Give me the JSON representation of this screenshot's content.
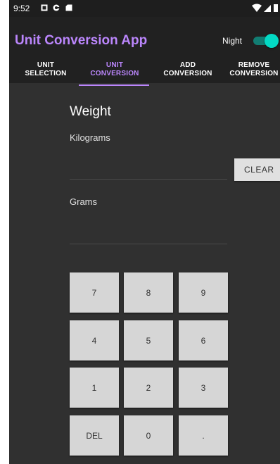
{
  "status_bar": {
    "time": "9:52",
    "icons": [
      "notification-icon",
      "app-icon",
      "sd-card-icon"
    ],
    "right_icons": [
      "wifi-icon",
      "signal-icon",
      "battery-icon"
    ]
  },
  "app_bar": {
    "title": "Unit Conversion App",
    "night_label": "Night",
    "night_mode_on": true,
    "accent_color": "#bb86fc",
    "switch_color": "#03dac5"
  },
  "tabs": [
    {
      "line1": "UNIT",
      "line2": "SELECTION",
      "active": false
    },
    {
      "line1": "UNIT",
      "line2": "CONVERSION",
      "active": true
    },
    {
      "line1": "ADD",
      "line2": "CONVERSION",
      "active": false
    },
    {
      "line1": "REMOVE",
      "line2": "CONVERSION",
      "active": false
    }
  ],
  "conversion": {
    "category": "Weight",
    "from_label": "Kilograms",
    "from_value": "",
    "to_label": "Grams",
    "to_value": "",
    "clear_label": "CLEAR"
  },
  "keypad": {
    "keys": [
      [
        "7",
        "8",
        "9"
      ],
      [
        "4",
        "5",
        "6"
      ],
      [
        "1",
        "2",
        "3"
      ],
      [
        "DEL",
        "0",
        "."
      ]
    ]
  }
}
